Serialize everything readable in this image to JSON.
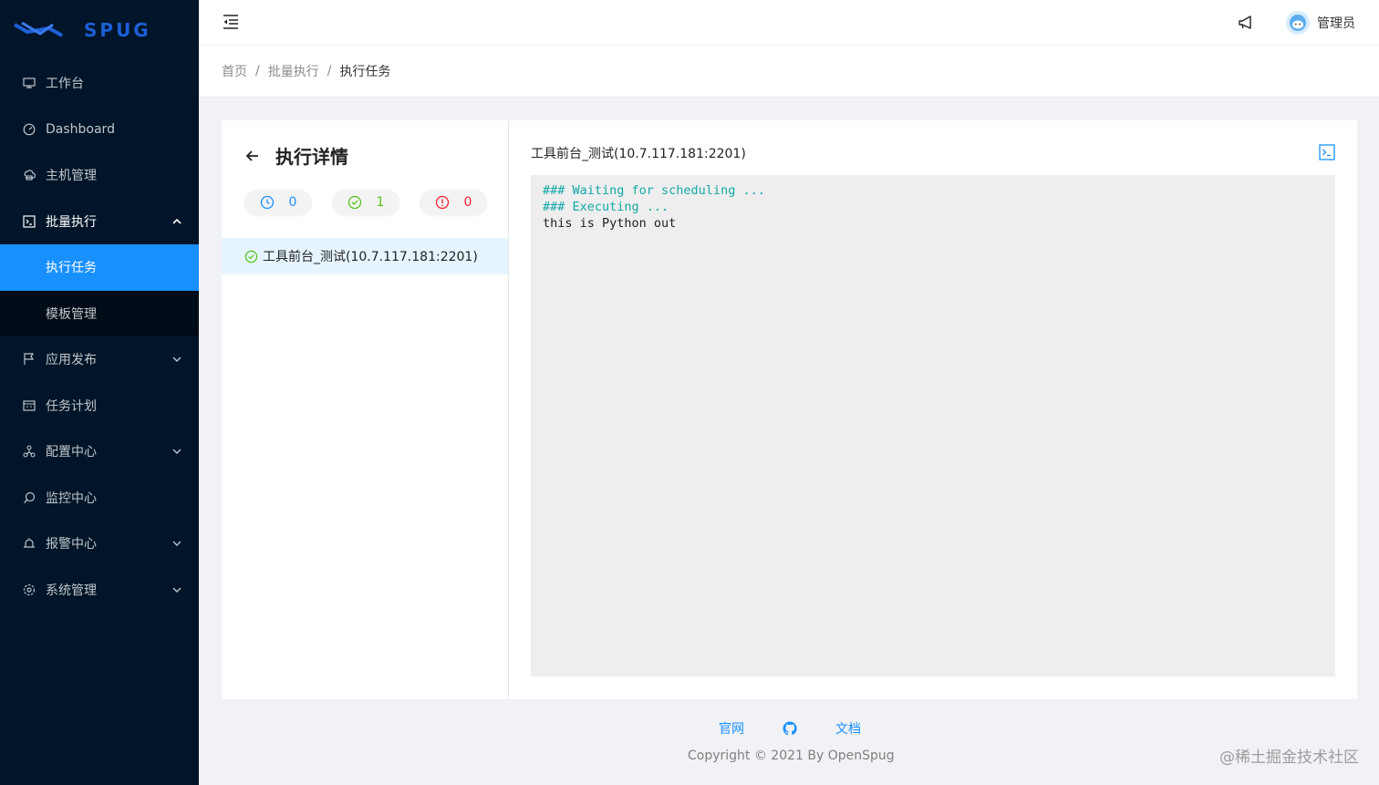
{
  "app": {
    "logo_text": "SPUG"
  },
  "sidebar": {
    "items": [
      {
        "label": "工作台",
        "icon": "desktop-icon"
      },
      {
        "label": "Dashboard",
        "icon": "dashboard-icon"
      },
      {
        "label": "主机管理",
        "icon": "cloud-server-icon"
      },
      {
        "label": "批量执行",
        "icon": "code-icon",
        "expanded": true,
        "children": [
          {
            "label": "执行任务",
            "active": true
          },
          {
            "label": "模板管理"
          }
        ]
      },
      {
        "label": "应用发布",
        "icon": "flag-icon"
      },
      {
        "label": "任务计划",
        "icon": "schedule-icon"
      },
      {
        "label": "配置中心",
        "icon": "deployment-unit-icon"
      },
      {
        "label": "监控中心",
        "icon": "monitor-search-icon"
      },
      {
        "label": "报警中心",
        "icon": "alarm-icon"
      },
      {
        "label": "系统管理",
        "icon": "setting-icon"
      }
    ]
  },
  "header": {
    "user_name": "管理员"
  },
  "breadcrumb": [
    "首页",
    "批量执行",
    "执行任务"
  ],
  "detail": {
    "title": "执行详情",
    "counters": {
      "pending": "0",
      "success": "1",
      "failed": "0"
    },
    "hosts": [
      {
        "label": "工具前台_测试(10.7.117.181:2201)",
        "status": "success"
      }
    ],
    "current_host": "工具前台_测试(10.7.117.181:2201)",
    "output": [
      {
        "type": "info",
        "text": "### Waiting for scheduling ..."
      },
      {
        "type": "info",
        "text": "### Executing ..."
      },
      {
        "type": "out",
        "text": "this is Python out"
      }
    ]
  },
  "footer": {
    "link_site": "官网",
    "link_docs": "文档",
    "copyright": "Copyright © 2021 By OpenSpug"
  },
  "watermark": "@稀土掘金技术社区",
  "colors": {
    "sidebar_bg": "#001529",
    "accent": "#1890ff",
    "success": "#52c41a",
    "error": "#f5222d",
    "info": "#13a8a8"
  }
}
